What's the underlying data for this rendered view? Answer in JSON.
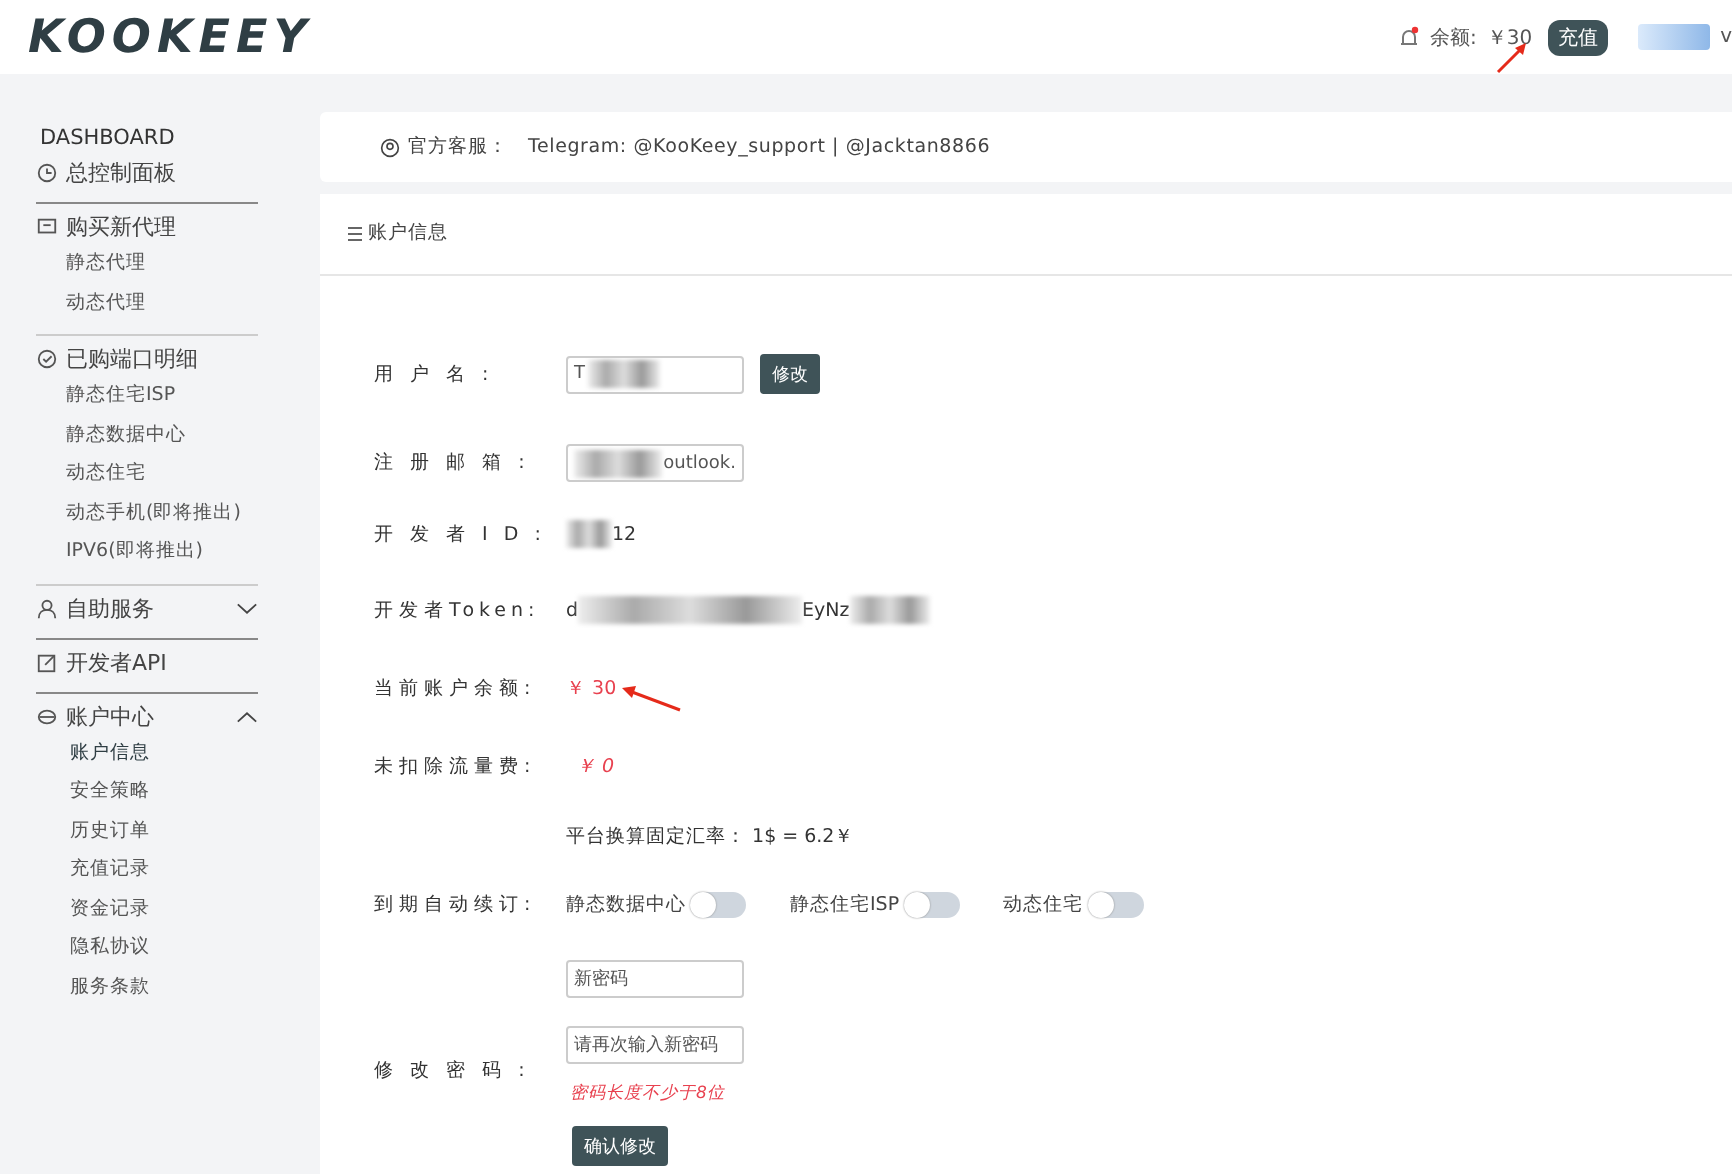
{
  "header": {
    "logo": "KOOKEEY",
    "balance_label": "余额:",
    "balance": "￥30",
    "recharge_button": "充值",
    "user_initial": "v"
  },
  "sidebar": {
    "title": "DASHBOARD",
    "sections": [
      {
        "label": "总控制面板"
      },
      {
        "label": "购买新代理",
        "items": [
          {
            "label": "静态代理",
            "selected": false
          },
          {
            "label": "动态代理",
            "selected": false
          }
        ]
      },
      {
        "label": "已购端口明细",
        "items": [
          {
            "label": "静态住宅ISP",
            "selected": false
          },
          {
            "label": "静态数据中心",
            "selected": false
          },
          {
            "label": "动态住宅",
            "selected": false
          },
          {
            "label": "动态手机(即将推出)",
            "selected": false
          },
          {
            "label": "IPV6(即将推出)",
            "selected": false
          }
        ]
      },
      {
        "label": "自助服务",
        "expanded": false
      },
      {
        "label": "开发者API"
      },
      {
        "label": "账户中心",
        "expanded": true,
        "items": [
          {
            "label": "账户信息",
            "selected": true
          },
          {
            "label": "安全策略",
            "selected": false
          },
          {
            "label": "历史订单",
            "selected": false
          },
          {
            "label": "充值记录",
            "selected": false
          },
          {
            "label": "资金记录",
            "selected": false
          },
          {
            "label": "隐私协议",
            "selected": false
          },
          {
            "label": "服务条款",
            "selected": false
          }
        ]
      }
    ]
  },
  "notice": {
    "label": "官方客服：",
    "text": "Telegram: @KooKeey_support | @Jacktan8866"
  },
  "panel": {
    "title": "账户信息",
    "username": {
      "label": "用 户 名 :",
      "value": "T",
      "button": "修改"
    },
    "email": {
      "label": "注 册 邮 箱 :",
      "value": "outlook."
    },
    "developer_id": {
      "label": "开 发 者 I D :",
      "value": "12"
    },
    "token": {
      "label": "开发者Token:",
      "value_start": "d",
      "value_end": "EyNz"
    },
    "balance": {
      "label": "当前账户余额:",
      "value": "￥ 30"
    },
    "unpaid": {
      "label": "未扣除流量费:",
      "value": "￥ 0"
    },
    "rate": "平台换算固定汇率： 1$ = 6.2￥",
    "auto_renew": {
      "label": "到期自动续订:",
      "toggles": [
        {
          "label": "静态数据中心",
          "on": false
        },
        {
          "label": "静态住宅ISP",
          "on": false
        },
        {
          "label": "动态住宅",
          "on": false
        }
      ]
    },
    "password": {
      "label": "修 改 密 码 :",
      "new_placeholder": "新密码",
      "repeat_placeholder": "请再次输入新密码",
      "hint": "密码长度不少于8位",
      "button": "确认修改"
    }
  }
}
